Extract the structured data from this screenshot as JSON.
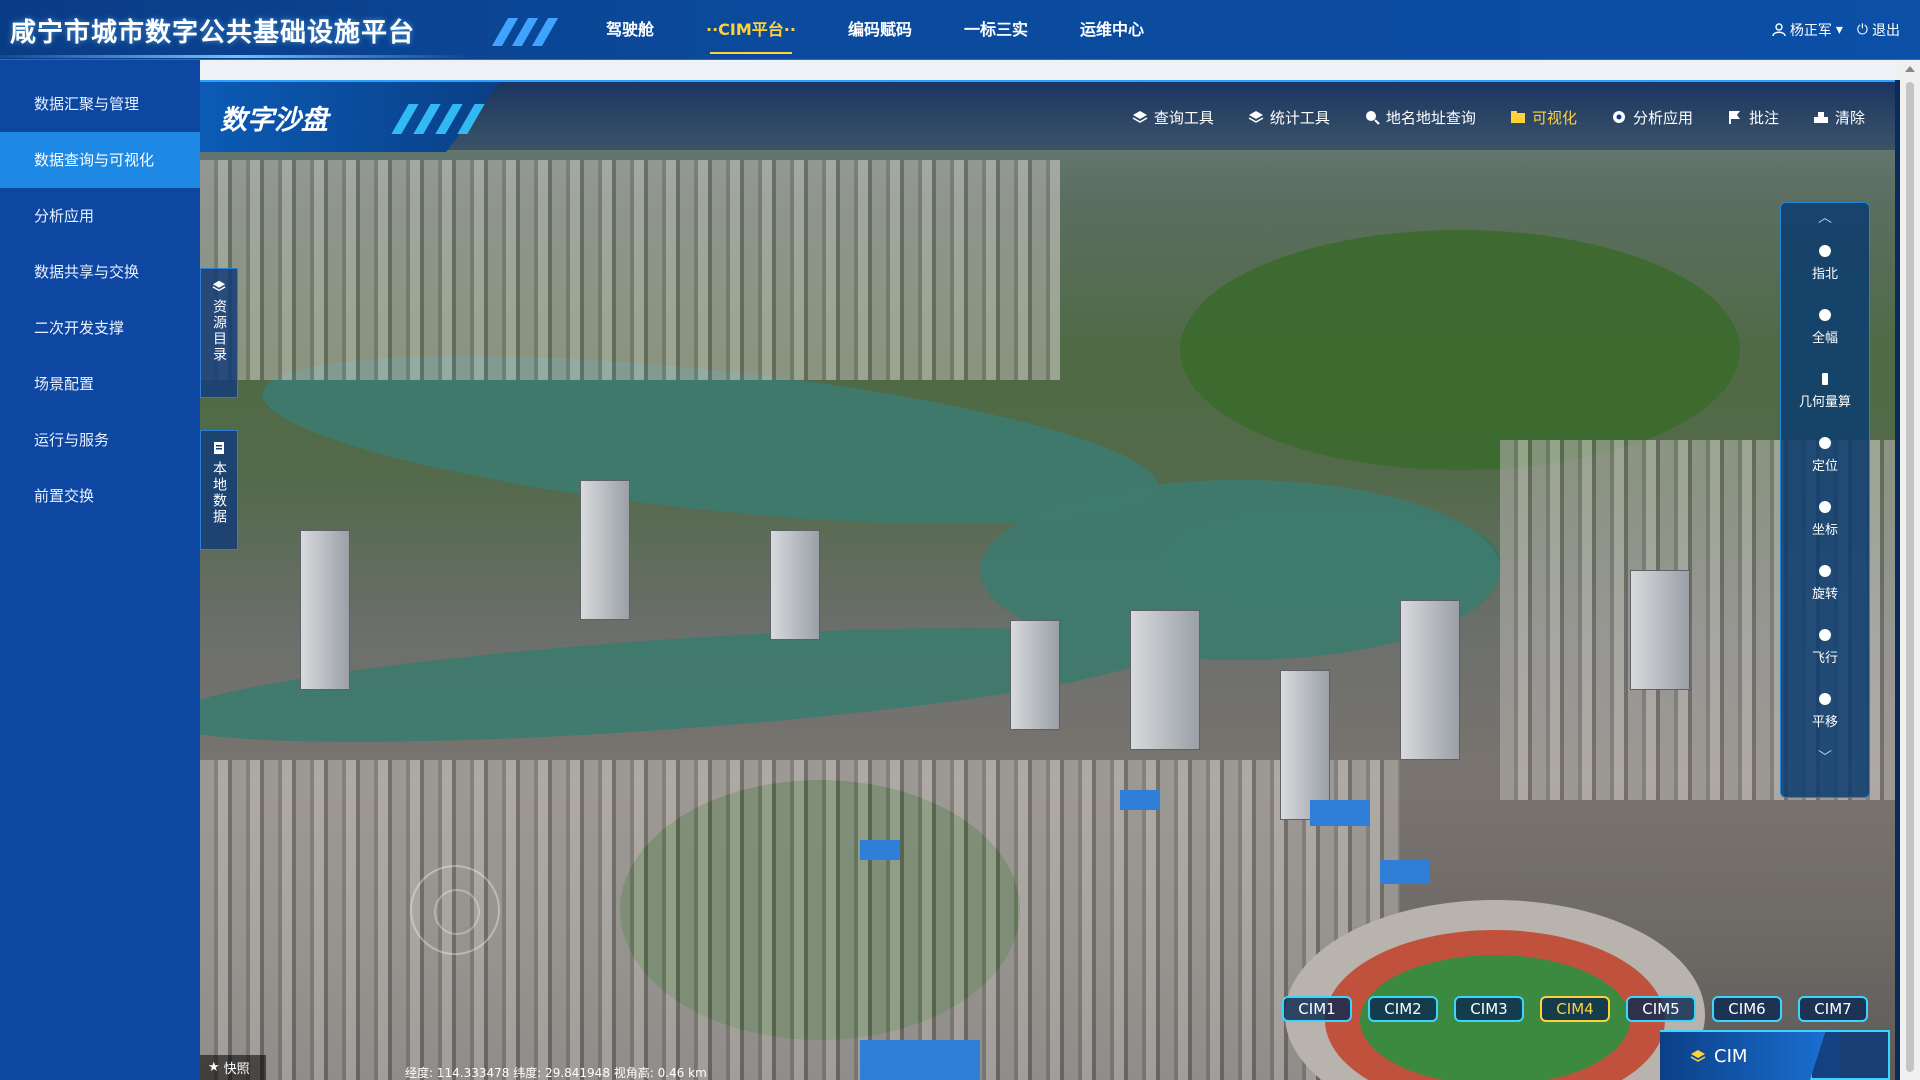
{
  "app": {
    "title": "咸宁市城市数字公共基础设施平台"
  },
  "nav": [
    {
      "label": "驾驶舱"
    },
    {
      "label": "··CIM平台··"
    },
    {
      "label": "编码赋码"
    },
    {
      "label": "一标三实"
    },
    {
      "label": "运维中心"
    }
  ],
  "user": {
    "name": "杨正军",
    "logout": "退出"
  },
  "sidebar": [
    {
      "label": "数据汇聚与管理"
    },
    {
      "label": "数据查询与可视化"
    },
    {
      "label": "分析应用"
    },
    {
      "label": "数据共享与交换"
    },
    {
      "label": "二次开发支撑"
    },
    {
      "label": "场景配置"
    },
    {
      "label": "运行与服务"
    },
    {
      "label": "前置交换"
    }
  ],
  "map": {
    "title": "数字沙盘",
    "tools": [
      {
        "label": "查询工具",
        "icon": "layers-icon"
      },
      {
        "label": "统计工具",
        "icon": "layers-icon"
      },
      {
        "label": "地名地址查询",
        "icon": "search-icon"
      },
      {
        "label": "可视化",
        "icon": "folder-icon"
      },
      {
        "label": "分析应用",
        "icon": "gear-icon"
      },
      {
        "label": "批注",
        "icon": "flag-icon"
      },
      {
        "label": "清除",
        "icon": "eraser-icon"
      }
    ],
    "left_tabs": [
      {
        "label": "资源目录",
        "icon": "layers-icon"
      },
      {
        "label": "本地数据",
        "icon": "file-icon"
      }
    ],
    "right_tools": [
      {
        "label": "指北"
      },
      {
        "label": "全幅"
      },
      {
        "label": "几何量算"
      },
      {
        "label": "定位"
      },
      {
        "label": "坐标"
      },
      {
        "label": "旋转"
      },
      {
        "label": "飞行"
      },
      {
        "label": "平移"
      }
    ],
    "cim_buttons": [
      "CIM1",
      "CIM2",
      "CIM3",
      "CIM4",
      "CIM5",
      "CIM6",
      "CIM7"
    ],
    "cim_badge": "CIM",
    "snapshot": "快照",
    "coordinates": "经度: 114.333478  纬度: 29.841948  视角高: 0.46 km"
  },
  "colors": {
    "accent": "#ffd23c",
    "sidebar": "#0d47a1",
    "sidebar_active": "#1e88e5",
    "cyan": "#3bd6ff"
  }
}
